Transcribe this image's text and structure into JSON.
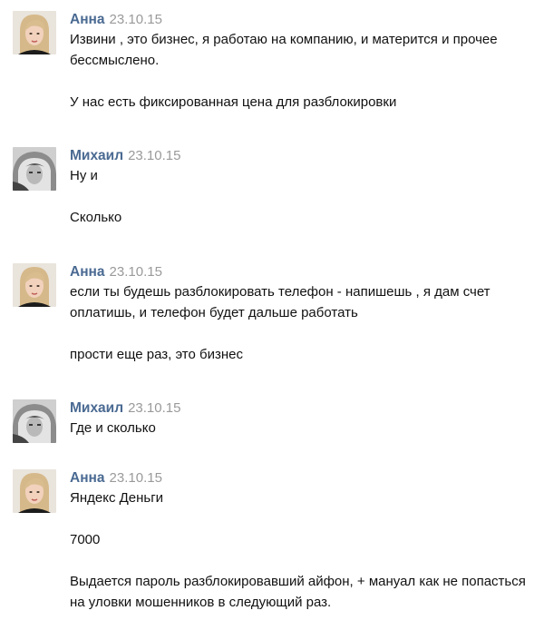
{
  "messages": [
    {
      "author": "Анна",
      "date": "23.10.15",
      "paragraphs": [
        "Извини , это бизнес, я работаю на компанию, и матерится и прочее бессмыслено.",
        "У нас есть фиксированная цена для разблокировки"
      ]
    },
    {
      "author": "Михаил",
      "date": "23.10.15",
      "paragraphs": [
        "Ну и",
        "Сколько"
      ]
    },
    {
      "author": "Анна",
      "date": "23.10.15",
      "paragraphs": [
        "если ты будешь разблокировать телефон - напишешь , я дам счет оплатишь, и телефон будет дальше работать",
        "прости еще раз, это бизнес"
      ]
    },
    {
      "author": "Михаил",
      "date": "23.10.15",
      "paragraphs": [
        "Где и сколько"
      ]
    },
    {
      "author": "Анна",
      "date": "23.10.15",
      "paragraphs": [
        "Яндекс Деньги",
        "7000",
        "Выдается пароль разблокировавший айфон, + мануал как не попасться на уловки мошенников в следующий раз."
      ]
    }
  ],
  "colors": {
    "author_name": "#4a6a92",
    "date": "#9a9a9a",
    "text": "#111111",
    "background": "#ffffff"
  },
  "icons": {
    "anna_avatar": "woman-portrait-photo",
    "mikhail_avatar": "hooded-person-bw-photo"
  }
}
